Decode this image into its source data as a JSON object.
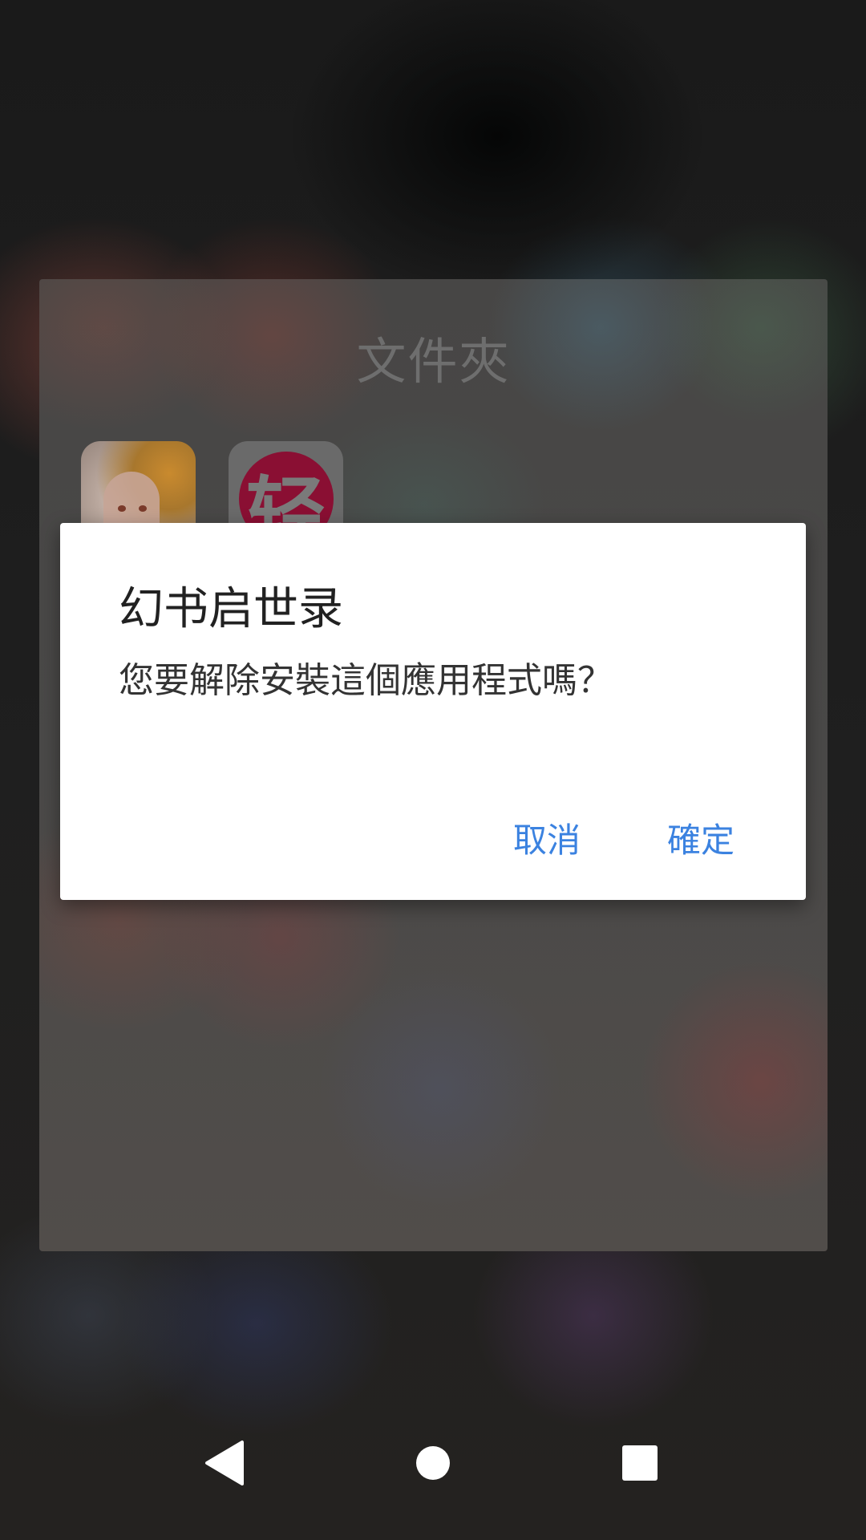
{
  "folder": {
    "title": "文件夾",
    "apps": [
      {
        "icon": "anime-girl-app-icon"
      },
      {
        "icon": "qing-app-icon",
        "glyph": "轻"
      }
    ]
  },
  "dialog": {
    "title": "幻书启世录",
    "message": "您要解除安裝這個應用程式嗎？",
    "cancel_label": "取消",
    "ok_label": "確定"
  },
  "navbar": {
    "back_icon": "back-triangle-icon",
    "home_icon": "home-circle-icon",
    "recents_icon": "recents-square-icon"
  },
  "colors": {
    "accent": "#3b82e0",
    "dialog_bg": "#ffffff",
    "title_text": "#212121"
  }
}
